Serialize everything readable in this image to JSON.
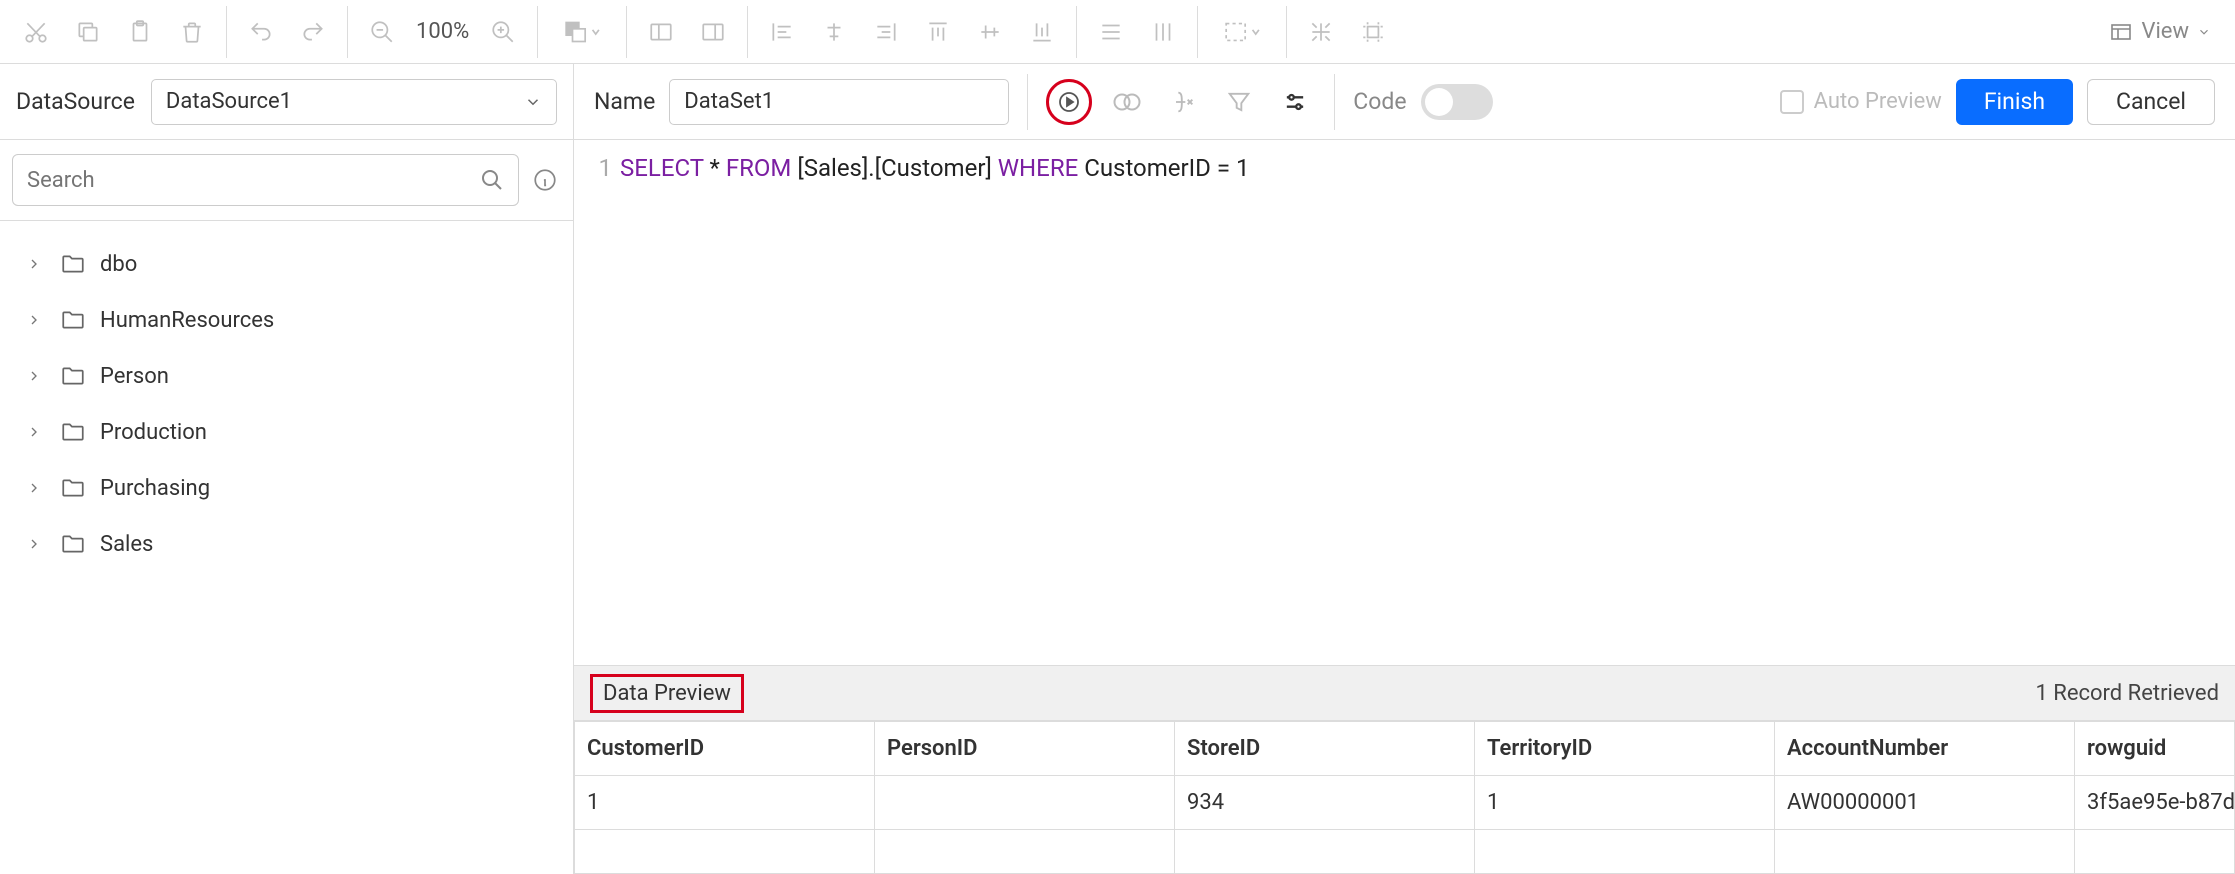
{
  "toolbar": {
    "zoom": "100%",
    "view_label": "View"
  },
  "left_sub": {
    "datasource_label": "DataSource",
    "datasource_value": "DataSource1"
  },
  "right_sub": {
    "name_label": "Name",
    "name_value": "DataSet1",
    "code_label": "Code",
    "auto_preview_label": "Auto Preview",
    "finish_label": "Finish",
    "cancel_label": "Cancel"
  },
  "sidebar": {
    "search_placeholder": "Search",
    "items": [
      {
        "label": "dbo"
      },
      {
        "label": "HumanResources"
      },
      {
        "label": "Person"
      },
      {
        "label": "Production"
      },
      {
        "label": "Purchasing"
      },
      {
        "label": "Sales"
      }
    ]
  },
  "editor": {
    "line_number": "1",
    "kw_select": "SELECT",
    "star": " *  ",
    "kw_from": "FROM",
    "table_ref": " [Sales].[Customer] ",
    "kw_where": "WHERE",
    "cond": "  CustomerID = 1"
  },
  "preview": {
    "header_label": "Data Preview",
    "records_text": "1 Record Retrieved",
    "columns": [
      "CustomerID",
      "PersonID",
      "StoreID",
      "TerritoryID",
      "AccountNumber",
      "rowguid"
    ],
    "col_align": [
      "num",
      "num",
      "num",
      "num",
      "left",
      "left"
    ],
    "rows": [
      [
        "1",
        "",
        "934",
        "1",
        "AW00000001",
        "3f5ae95e-b87d"
      ]
    ]
  }
}
